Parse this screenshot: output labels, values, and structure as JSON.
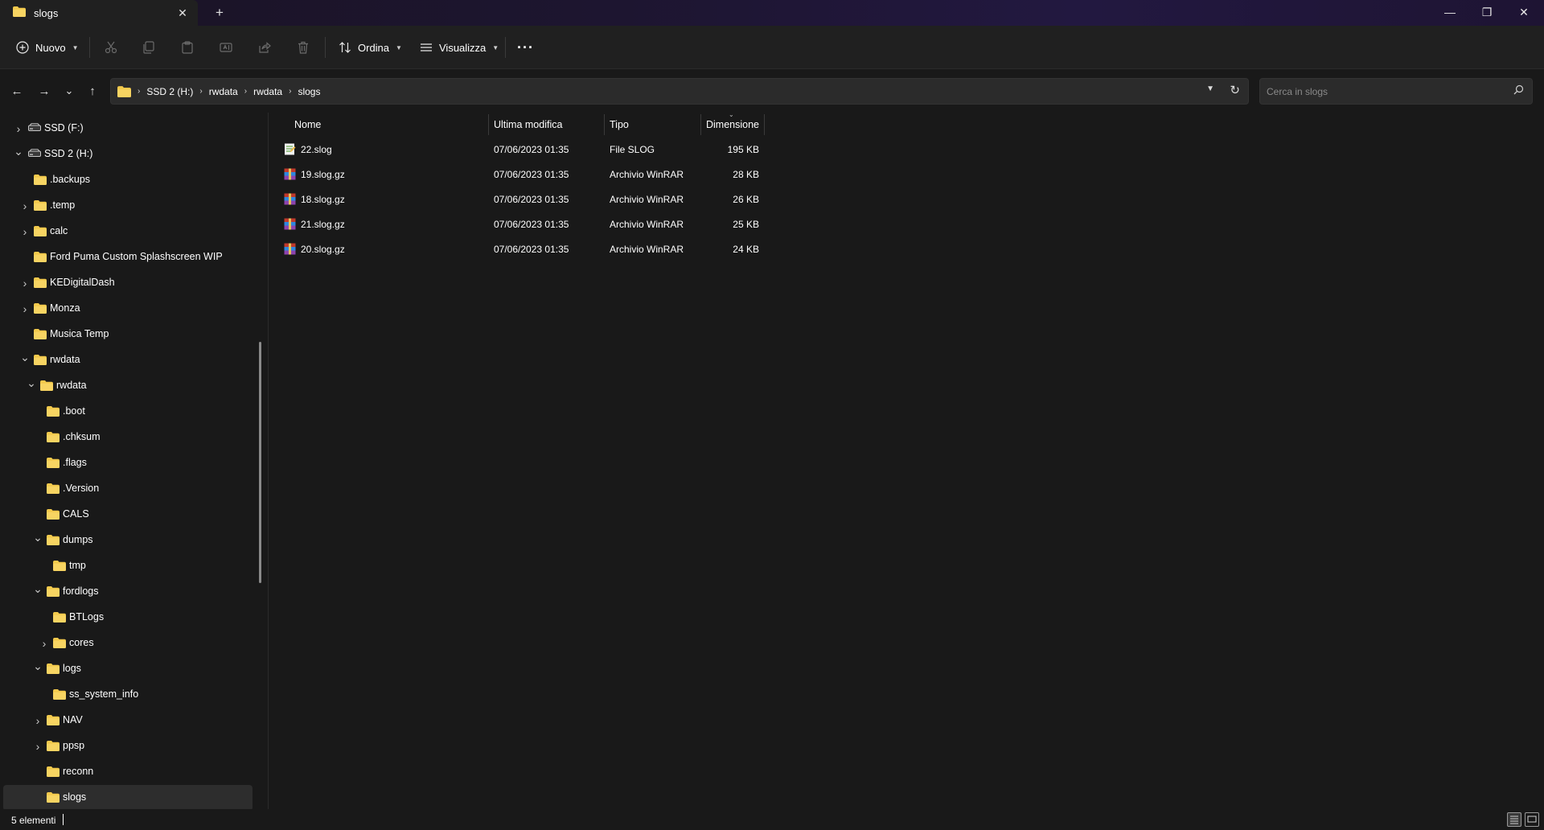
{
  "window": {
    "tab_title": "slogs",
    "tab_icon": "folder-icon",
    "new_tab_glyph": "+",
    "close_tab_glyph": "✕",
    "minimize_glyph": "—",
    "maximize_glyph": "❐",
    "close_glyph": "✕"
  },
  "toolbar": {
    "new_label": "Nuovo",
    "sort_label": "Ordina",
    "view_label": "Visualizza",
    "more_glyph": "···",
    "icons": [
      "cut-icon",
      "copy-icon",
      "paste-icon",
      "rename-icon",
      "share-icon",
      "delete-icon"
    ]
  },
  "navigation": {
    "back_glyph": "←",
    "forward_glyph": "→",
    "recent_glyph": "⌄",
    "up_glyph": "↑"
  },
  "address": {
    "crumbs": [
      "SSD 2 (H:)",
      "rwdata",
      "rwdata",
      "slogs"
    ],
    "refresh_glyph": "↻"
  },
  "search": {
    "placeholder": "Cerca in slogs"
  },
  "sidebar": {
    "items": [
      {
        "label": "SSD (F:)",
        "type": "drive",
        "level": 0,
        "chevron": "right"
      },
      {
        "label": "SSD 2 (H:)",
        "type": "drive",
        "level": 0,
        "chevron": "down"
      },
      {
        "label": ".backups",
        "type": "folder",
        "level": 1,
        "chevron": "none"
      },
      {
        "label": ".temp",
        "type": "folder",
        "level": 1,
        "chevron": "right"
      },
      {
        "label": "calc",
        "type": "folder",
        "level": 1,
        "chevron": "right"
      },
      {
        "label": "Ford Puma Custom Splashscreen WIP",
        "type": "folder",
        "level": 1,
        "chevron": "none"
      },
      {
        "label": "KEDigitalDash",
        "type": "folder",
        "level": 1,
        "chevron": "right"
      },
      {
        "label": "Monza",
        "type": "folder",
        "level": 1,
        "chevron": "right"
      },
      {
        "label": "Musica Temp",
        "type": "folder",
        "level": 1,
        "chevron": "none"
      },
      {
        "label": "rwdata",
        "type": "folder",
        "level": 1,
        "chevron": "down"
      },
      {
        "label": "rwdata",
        "type": "folder",
        "level": 2,
        "chevron": "down"
      },
      {
        "label": ".boot",
        "type": "folder",
        "level": 3,
        "chevron": "none"
      },
      {
        "label": ".chksum",
        "type": "folder",
        "level": 3,
        "chevron": "none"
      },
      {
        "label": ".flags",
        "type": "folder",
        "level": 3,
        "chevron": "none"
      },
      {
        "label": ".Version",
        "type": "folder",
        "level": 3,
        "chevron": "none"
      },
      {
        "label": "CALS",
        "type": "folder",
        "level": 3,
        "chevron": "none"
      },
      {
        "label": "dumps",
        "type": "folder",
        "level": 3,
        "chevron": "down"
      },
      {
        "label": "tmp",
        "type": "folder",
        "level": 4,
        "chevron": "none"
      },
      {
        "label": "fordlogs",
        "type": "folder",
        "level": 3,
        "chevron": "down"
      },
      {
        "label": "BTLogs",
        "type": "folder",
        "level": 4,
        "chevron": "none"
      },
      {
        "label": "cores",
        "type": "folder",
        "level": 4,
        "chevron": "right"
      },
      {
        "label": "logs",
        "type": "folder",
        "level": 3,
        "chevron": "down"
      },
      {
        "label": "ss_system_info",
        "type": "folder",
        "level": 4,
        "chevron": "none"
      },
      {
        "label": "NAV",
        "type": "folder",
        "level": 3,
        "chevron": "right"
      },
      {
        "label": "ppsp",
        "type": "folder",
        "level": 3,
        "chevron": "right"
      },
      {
        "label": "reconn",
        "type": "folder",
        "level": 3,
        "chevron": "none"
      },
      {
        "label": "slogs",
        "type": "folder",
        "level": 3,
        "chevron": "none",
        "selected": true
      }
    ]
  },
  "columns": {
    "name": "Nome",
    "modified": "Ultima modifica",
    "type": "Tipo",
    "size": "Dimensione"
  },
  "files": [
    {
      "name": "22.slog",
      "modified": "07/06/2023 01:35",
      "type": "File SLOG",
      "size": "195 KB",
      "icon": "text-file-icon"
    },
    {
      "name": "19.slog.gz",
      "modified": "07/06/2023 01:35",
      "type": "Archivio WinRAR",
      "size": "28 KB",
      "icon": "winrar-archive-icon"
    },
    {
      "name": "18.slog.gz",
      "modified": "07/06/2023 01:35",
      "type": "Archivio WinRAR",
      "size": "26 KB",
      "icon": "winrar-archive-icon"
    },
    {
      "name": "21.slog.gz",
      "modified": "07/06/2023 01:35",
      "type": "Archivio WinRAR",
      "size": "25 KB",
      "icon": "winrar-archive-icon"
    },
    {
      "name": "20.slog.gz",
      "modified": "07/06/2023 01:35",
      "type": "Archivio WinRAR",
      "size": "24 KB",
      "icon": "winrar-archive-icon"
    }
  ],
  "status": {
    "count": "5 elementi"
  },
  "colors": {
    "folder": "#f2c94c",
    "background": "#191919",
    "toolbar": "#202020"
  }
}
